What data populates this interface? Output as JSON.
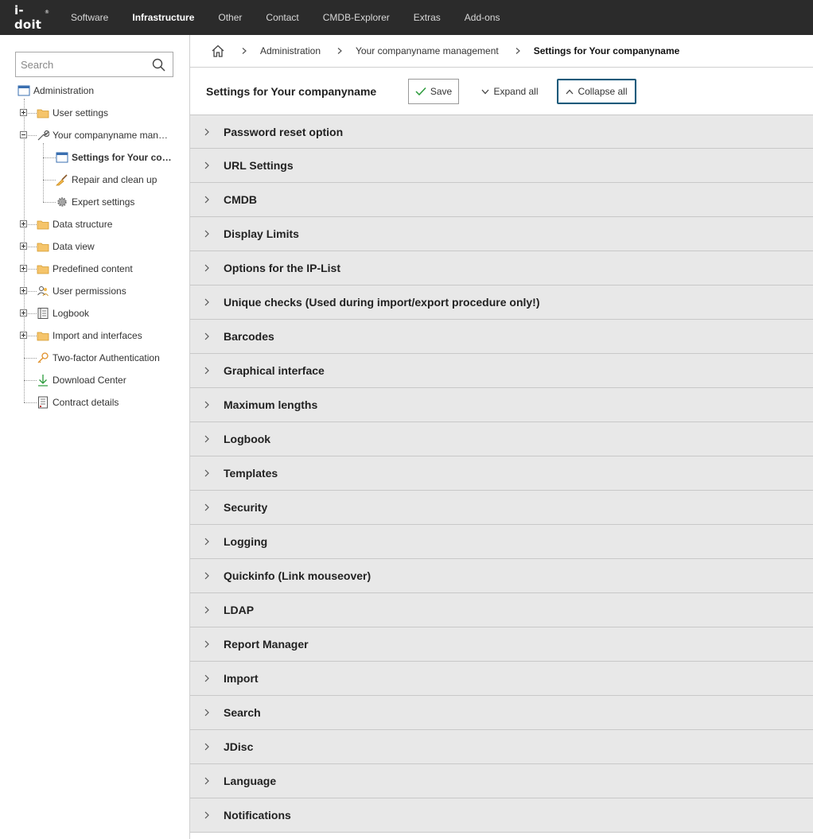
{
  "app": {
    "logo_text": "i-doit"
  },
  "topnav": {
    "items": [
      {
        "label": "Software",
        "active": false
      },
      {
        "label": "Infrastructure",
        "active": true
      },
      {
        "label": "Other",
        "active": false
      },
      {
        "label": "Contact",
        "active": false
      },
      {
        "label": "CMDB-Explorer",
        "active": false
      },
      {
        "label": "Extras",
        "active": false
      },
      {
        "label": "Add-ons",
        "active": false
      }
    ]
  },
  "sidebar": {
    "search_placeholder": "Search",
    "tree": [
      {
        "label": "Administration",
        "icon": "window-icon"
      },
      {
        "label": "User settings",
        "icon": "folder-icon"
      },
      {
        "label": "Your companyname man…",
        "icon": "wrench-icon"
      },
      {
        "label": "Settings for Your co…",
        "icon": "window-icon",
        "selected": true
      },
      {
        "label": "Repair and clean up",
        "icon": "broom-icon"
      },
      {
        "label": "Expert settings",
        "icon": "gear-icon"
      },
      {
        "label": "Data structure",
        "icon": "folder-icon"
      },
      {
        "label": "Data view",
        "icon": "folder-icon"
      },
      {
        "label": "Predefined content",
        "icon": "folder-icon"
      },
      {
        "label": "User permissions",
        "icon": "users-icon"
      },
      {
        "label": "Logbook",
        "icon": "logbook-icon"
      },
      {
        "label": "Import and interfaces",
        "icon": "folder-icon"
      },
      {
        "label": "Two-factor Authentication",
        "icon": "key-icon"
      },
      {
        "label": "Download Center",
        "icon": "download-icon"
      },
      {
        "label": "Contract details",
        "icon": "contract-icon"
      }
    ]
  },
  "breadcrumb": {
    "items": [
      "Administration",
      "Your companyname management",
      "Settings for Your companyname"
    ]
  },
  "header": {
    "title": "Settings for Your companyname",
    "save_label": "Save",
    "expand_label": "Expand all",
    "collapse_label": "Collapse all"
  },
  "sections": [
    "Password reset option",
    "URL Settings",
    "CMDB",
    "Display Limits",
    "Options for the IP-List",
    "Unique checks (Used during import/export procedure only!)",
    "Barcodes",
    "Graphical interface",
    "Maximum lengths",
    "Logbook",
    "Templates",
    "Security",
    "Logging",
    "Quickinfo (Link mouseover)",
    "LDAP",
    "Report Manager",
    "Import",
    "Search",
    "JDisc",
    "Language",
    "Notifications"
  ],
  "colors": {
    "topbar_bg": "#2b2b2b",
    "section_bg": "#e8e8e8",
    "collapse_border": "#1c5a7a",
    "folder": "#f5c46a"
  }
}
